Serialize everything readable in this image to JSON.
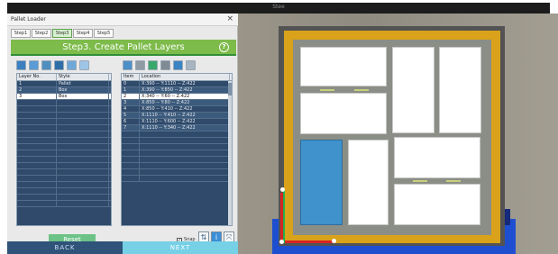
{
  "window": {
    "title": "Stee"
  },
  "panel": {
    "title": "Pallet Loader",
    "close_label": "×",
    "steps": [
      {
        "label": "Step1"
      },
      {
        "label": "Step2"
      },
      {
        "label": "Step3",
        "active": true
      },
      {
        "label": "Step4"
      },
      {
        "label": "Step5"
      }
    ],
    "banner_title": "Step3. Create Pallet Layers",
    "help_label": "?",
    "toolbar_left": [
      "layer-add-icon",
      "layer-list-icon",
      "layer-copy-icon",
      "layer-delete-icon",
      "layer-up-icon",
      "layer-down-icon"
    ],
    "toolbar_right": [
      "item-add-icon",
      "item-remove-icon",
      "item-image-icon",
      "item-move-icon",
      "item-export-icon",
      "item-trash-icon"
    ]
  },
  "layers_table": {
    "headers": [
      "Layer No.",
      "Style"
    ],
    "rows": [
      [
        "1",
        "Pallet"
      ],
      [
        "2",
        "Box"
      ],
      [
        "3",
        "Box"
      ]
    ],
    "selected_row": 2,
    "empty_rows": 17
  },
  "items_table": {
    "headers": [
      "Item",
      "Location"
    ],
    "rows": [
      [
        "0",
        "X:390 -- Y:1110 -- Z:422"
      ],
      [
        "1",
        "X:390 -- Y:850 -- Z:422"
      ],
      [
        "2",
        "X:340 -- Y:60 -- Z:422"
      ],
      [
        "3",
        "X:850 -- Y:80 -- Z:422"
      ],
      [
        "4",
        "X:850 -- Y:410 -- Z:422"
      ],
      [
        "5",
        "X:1110 -- Y:410 -- Z:422"
      ],
      [
        "6",
        "X:1110 -- Y:600 -- Z:422"
      ],
      [
        "7",
        "X:1110 -- Y:340 -- Z:422"
      ]
    ],
    "selected_row": 2,
    "empty_rows": 8
  },
  "reset_label": "Reset",
  "snap_label": "Snap",
  "snap_checked": true,
  "back_label": "BACK",
  "next_label": "NEXT",
  "colors": {
    "banner": "#7dbb4a",
    "reset": "#6cc287",
    "back": "#2f5379",
    "next": "#76d0e6",
    "pallet": "#d9a21a",
    "base": "#1f4fd1",
    "selected_box": "#3f92cc"
  }
}
